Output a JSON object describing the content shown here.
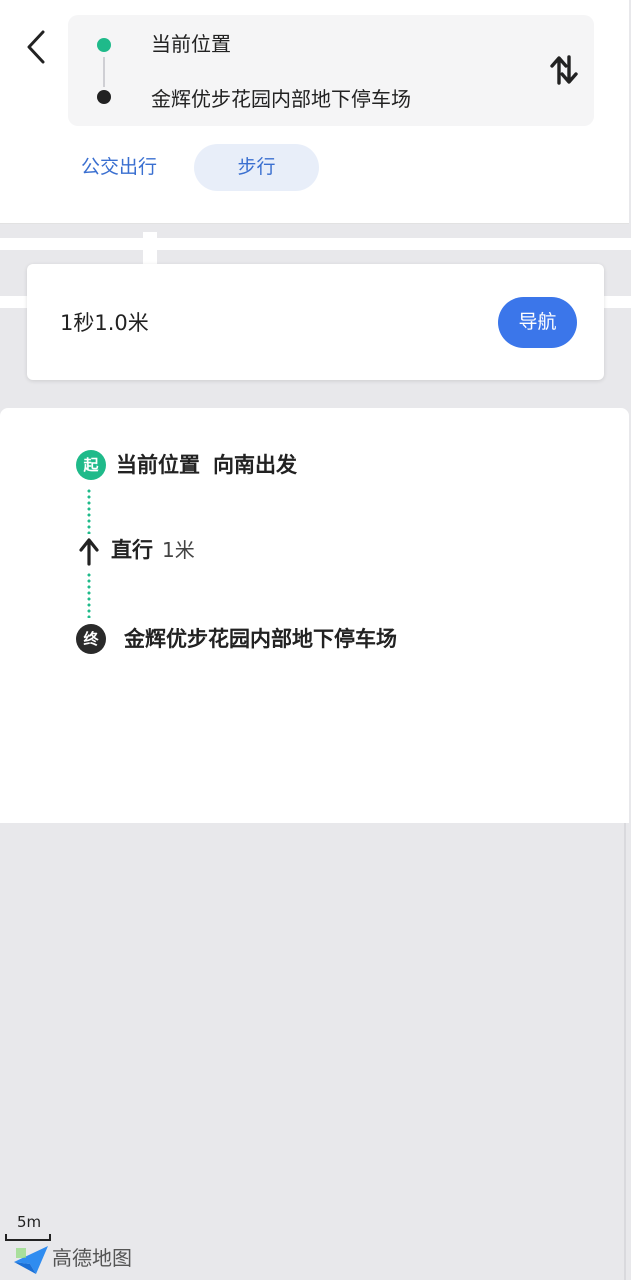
{
  "header": {
    "route": {
      "start": "当前位置",
      "end": "金辉优步花园内部地下停车场"
    },
    "tabs": [
      {
        "label": "公交出行",
        "active": false
      },
      {
        "label": "步行",
        "active": true
      }
    ]
  },
  "summary": {
    "text": "1秒1.0米",
    "nav_label": "导航"
  },
  "steps": {
    "start": {
      "badge": "起",
      "name": "当前位置",
      "direction": "向南出发"
    },
    "middle": {
      "action": "直行",
      "distance": "1米",
      "icon": "arrow-up-icon"
    },
    "end": {
      "badge": "终",
      "name": "金辉优步花园内部地下停车场"
    }
  },
  "map": {
    "scale_label": "5m",
    "logo_text": "高德地图"
  },
  "colors": {
    "accent": "#3b76ea",
    "tab_text": "#3a6fd0",
    "start_green": "#1fba8a",
    "end_dark": "#2a2a2a"
  }
}
